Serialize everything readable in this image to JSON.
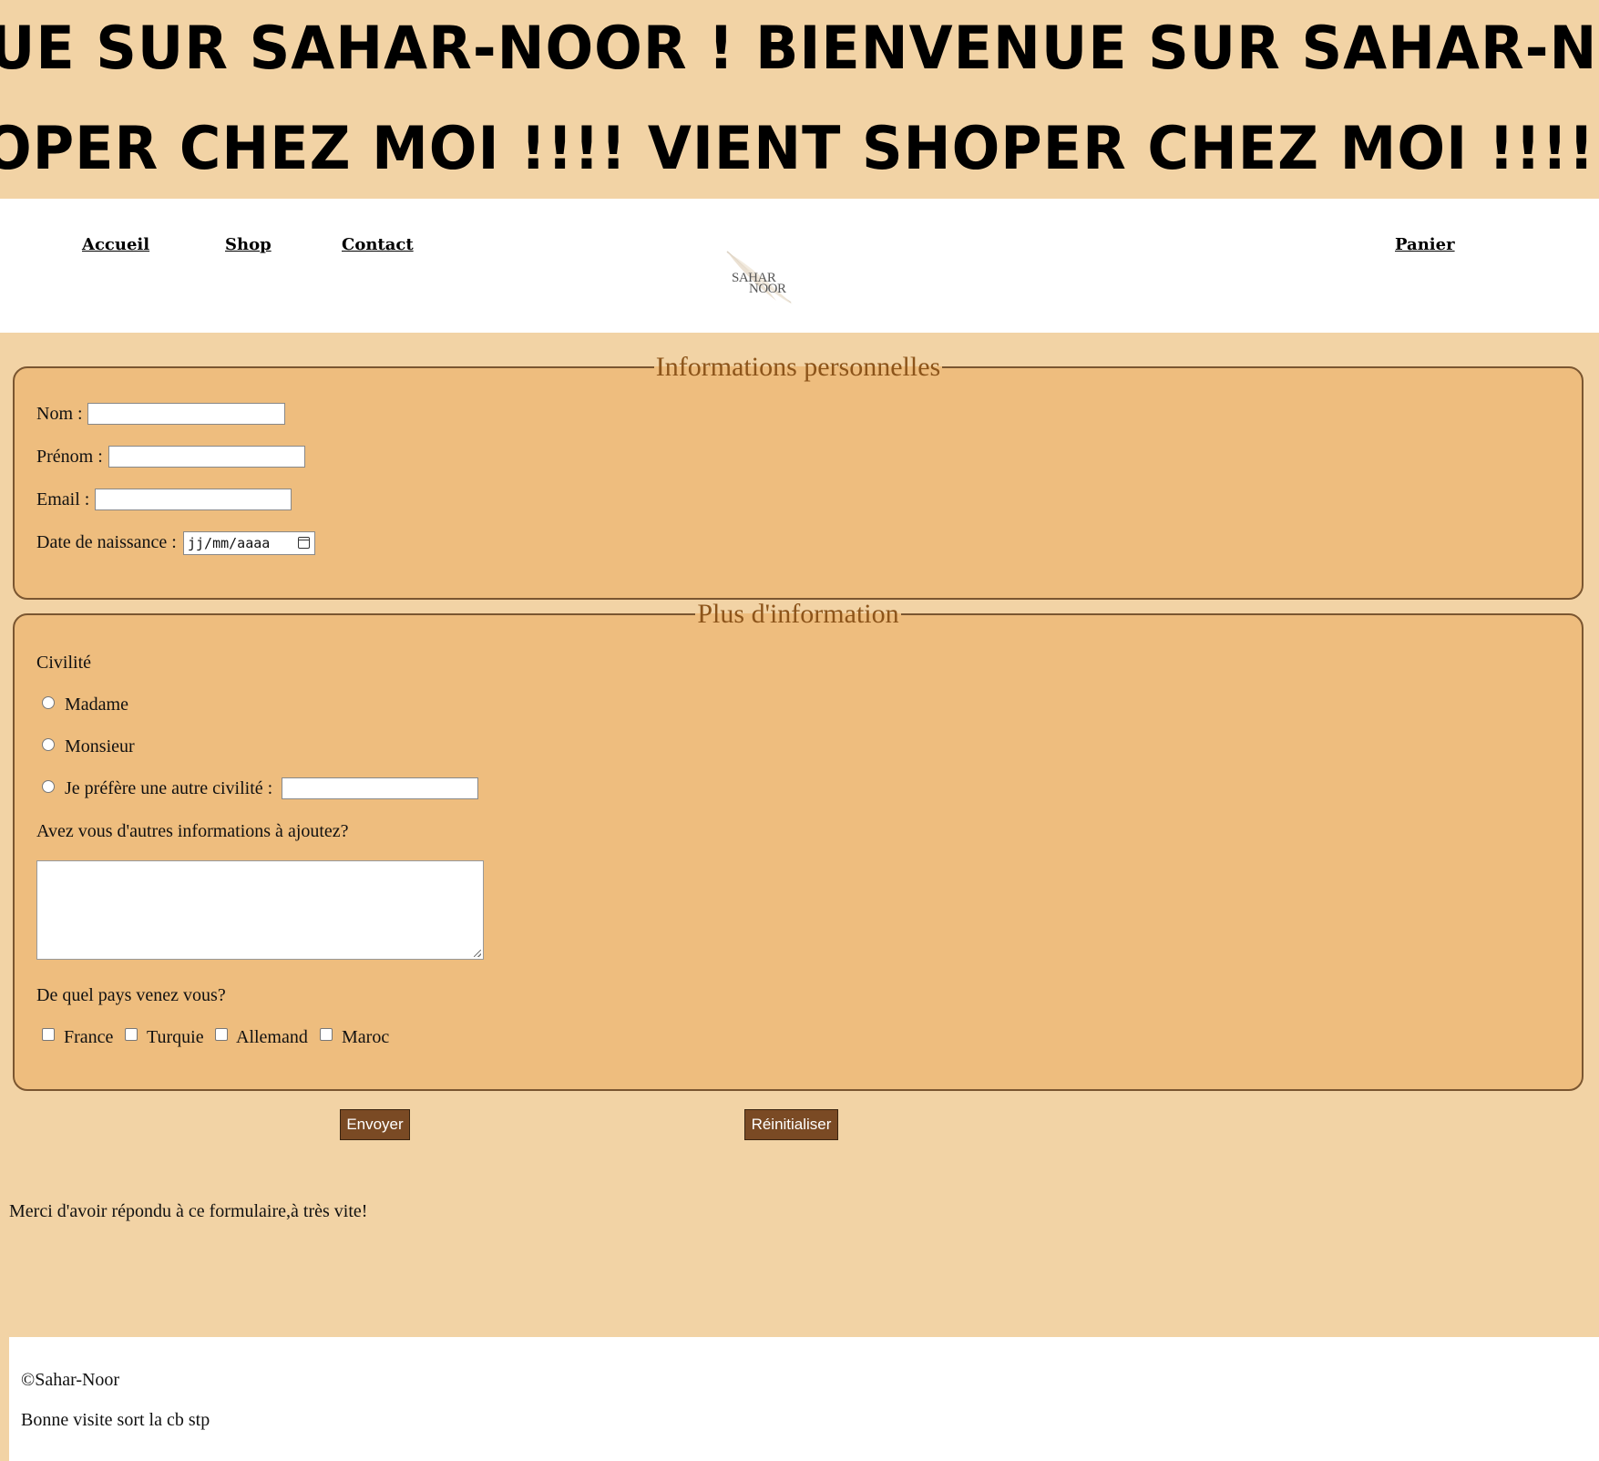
{
  "banner": {
    "line1": "UE SUR SAHAR-NOOR ! BIENVENUE SUR SAHAR-NOOR",
    "line2": "OPER CHEZ MOI !!!! VIENT SHOPER CHEZ MOI !!!!"
  },
  "nav": {
    "accueil": "Accueil",
    "shop": "Shop",
    "contact": "Contact",
    "panier": "Panier",
    "logo_line1": "SAHAR",
    "logo_line2": "NOOR"
  },
  "personal": {
    "legend": "Informations personnelles",
    "nom_label": "Nom :",
    "nom_value": "",
    "prenom_label": "Prénom :",
    "prenom_value": "",
    "email_label": "Email :",
    "email_value": "",
    "dob_label": "Date de naissance :",
    "dob_placeholder": "jj/mm/aaaa"
  },
  "more": {
    "legend": "Plus d'information",
    "civilite_label": "Civilité",
    "civilite_options": [
      "Madame",
      "Monsieur",
      "Je préfère une autre civilité :"
    ],
    "autre_civilite_value": "",
    "infos_question": "Avez vous d'autres informations à ajoutez?",
    "infos_value": "",
    "pays_question": "De quel pays venez vous?",
    "pays_options": [
      "France",
      "Turquie",
      "Allemand",
      "Maroc"
    ]
  },
  "buttons": {
    "submit": "Envoyer",
    "reset": "Réinitialiser"
  },
  "thanks": "Merci d'avoir répondu à ce formulaire,à très vite!",
  "footer": {
    "copyright": "©Sahar-Noor",
    "message": "Bonne visite sort la cb stp"
  }
}
